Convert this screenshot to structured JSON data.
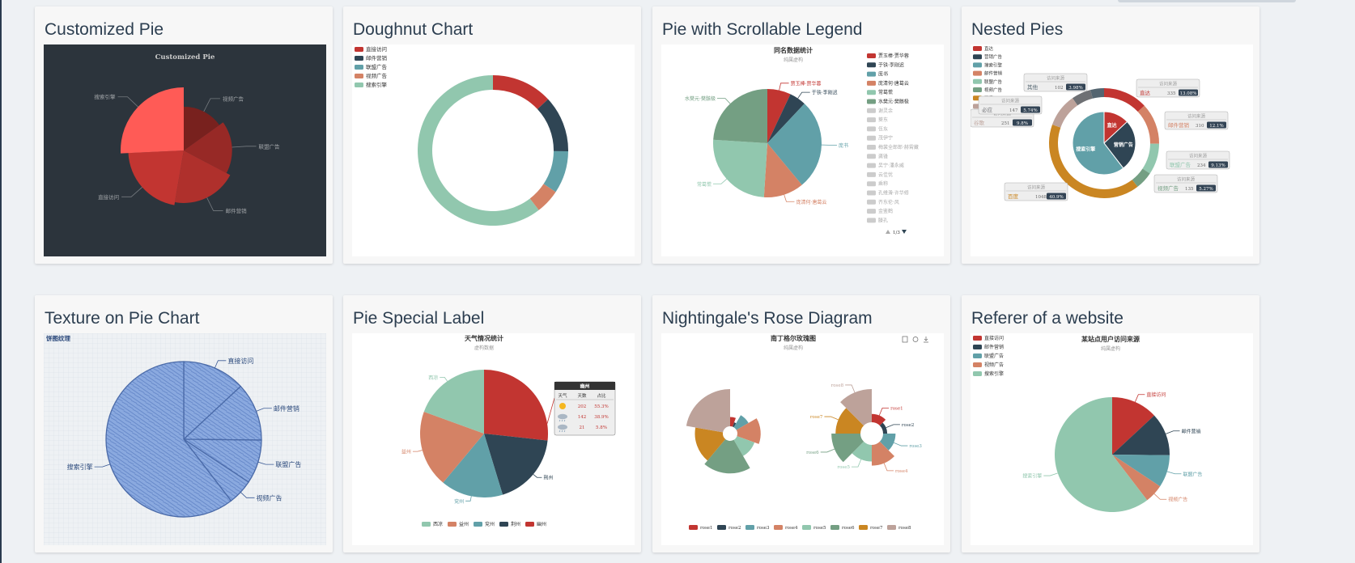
{
  "cards": [
    {
      "title": "Customized Pie"
    },
    {
      "title": "Doughnut Chart"
    },
    {
      "title": "Pie with Scrollable Legend"
    },
    {
      "title": "Nested Pies"
    },
    {
      "title": "Texture on Pie Chart"
    },
    {
      "title": "Pie Special Label"
    },
    {
      "title": "Nightingale's Rose Diagram"
    },
    {
      "title": "Referer of a website"
    }
  ],
  "chart_data": [
    {
      "type": "pie",
      "title": "Customized Pie",
      "roseType": "radius",
      "background": "#2c343c",
      "color": "#c23531",
      "categories": [
        "视频广告",
        "联盟广告",
        "邮件营销",
        "直接访问",
        "搜索引擎"
      ],
      "values": [
        235,
        274,
        310,
        335,
        400
      ],
      "labels": [
        "视频广告",
        "联盟广告",
        "邮件营销",
        "直接访问",
        "搜索引擎"
      ]
    },
    {
      "type": "pie",
      "donut": true,
      "legend": [
        "直接访问",
        "邮件营销",
        "联盟广告",
        "视频广告",
        "搜索引擎"
      ],
      "legend_position": "top-left",
      "values": [
        335,
        310,
        234,
        135,
        1548
      ],
      "colors": [
        "#c23531",
        "#2f4554",
        "#61a0a8",
        "#d48265",
        "#91c7ae"
      ]
    },
    {
      "type": "pie",
      "title": "同名数据统计",
      "subtitle": "纯属虚构",
      "legend_position": "right",
      "legend": [
        "贾玉棒·贾华蓉",
        "于铁·李刚迟",
        "庞书",
        "庞清何·唐葛云",
        "常葛慌",
        "水樊元·樊骸极",
        "谢灵余",
        "葵东",
        "伍东",
        "茂伊宁",
        "梅裳全郎郎·赫霄藏",
        "龚锋",
        "吴宁·潘永威",
        "云佳忧",
        "乘称",
        "孔维滑·许华修",
        "齐东伦·风",
        "金鉴鹤",
        "滕孔"
      ],
      "legend_active_count": 6,
      "legend_page": "1/3",
      "slices": [
        {
          "name": "贾玉棒·贾华蓉",
          "value": 7
        },
        {
          "name": "于铁·李刚迟",
          "value": 5
        },
        {
          "name": "庞书",
          "value": 27
        },
        {
          "name": "庞清何·唐葛云",
          "value": 12
        },
        {
          "name": "常葛慌",
          "value": 25
        },
        {
          "name": "水樊元·樊骸极",
          "value": 24
        }
      ],
      "colors": [
        "#c23531",
        "#2f4554",
        "#61a0a8",
        "#d48265",
        "#91c7ae",
        "#749f83"
      ]
    },
    {
      "type": "pie",
      "nested": true,
      "legend": [
        "直达",
        "营销广告",
        "搜索引擎",
        "邮件营销",
        "联盟广告",
        "视频广告",
        "百度",
        "谷歌",
        "必应",
        "其他"
      ],
      "legend_position": "top-left",
      "inner": [
        {
          "name": "直达",
          "value": 335
        },
        {
          "name": "营销广告",
          "value": 679
        },
        {
          "name": "搜索引擎",
          "value": 1548
        }
      ],
      "outer": [
        {
          "name": "直达",
          "value": 335,
          "pct": "13.08%"
        },
        {
          "name": "邮件营销",
          "value": 310,
          "pct": "12.1%"
        },
        {
          "name": "联盟广告",
          "value": 234,
          "pct": "9.13%"
        },
        {
          "name": "视频广告",
          "value": 135,
          "pct": "5.27%"
        },
        {
          "name": "百度",
          "value": 1048,
          "pct": "40.9%"
        },
        {
          "name": "谷歌",
          "value": 251,
          "pct": "9.8%"
        },
        {
          "name": "必应",
          "value": 147,
          "pct": "5.74%"
        },
        {
          "name": "其他",
          "value": 102,
          "pct": "3.98%"
        }
      ],
      "tooltip_title": "访问来源",
      "colors": [
        "#c23531",
        "#2f4554",
        "#61a0a8",
        "#d48265",
        "#91c7ae",
        "#749f83",
        "#ca8622",
        "#bda29a",
        "#6e7074",
        "#546570"
      ]
    },
    {
      "type": "pie",
      "title": "饼图纹理",
      "texture": true,
      "categories": [
        "直接访问",
        "邮件营销",
        "联盟广告",
        "视频广告",
        "搜索引擎"
      ],
      "values": [
        335,
        310,
        234,
        135,
        1548
      ]
    },
    {
      "type": "pie",
      "title": "天气情况统计",
      "subtitle": "虚构数据",
      "legend": [
        "西凉",
        "益州",
        "兖州",
        "荆州",
        "幽州"
      ],
      "legend_position": "bottom",
      "slices": [
        {
          "name": "幽州",
          "value": 735
        },
        {
          "name": "荆州",
          "value": 510
        },
        {
          "name": "兖州",
          "value": 434
        },
        {
          "name": "益州",
          "value": 535
        },
        {
          "name": "西凉",
          "value": 535
        }
      ],
      "colors": [
        "#c23531",
        "#2f4554",
        "#61a0a8",
        "#d48265",
        "#91c7ae"
      ],
      "special_label": {
        "title": "幽州",
        "headers": [
          "天气",
          "天数",
          "占比"
        ],
        "rows": [
          {
            "icon": "sunny-icon",
            "days": "202",
            "pct": "55.3%"
          },
          {
            "icon": "cloudy-icon",
            "days": "142",
            "pct": "38.9%"
          },
          {
            "icon": "showers-icon",
            "days": "21",
            "pct": "5.8%"
          }
        ]
      }
    },
    {
      "type": "pie",
      "roseType": true,
      "title": "南丁格尔玫瑰图",
      "subtitle": "纯属虚构",
      "legend": [
        "rose1",
        "rose2",
        "rose3",
        "rose4",
        "rose5",
        "rose6",
        "rose7",
        "rose8"
      ],
      "legend_position": "bottom",
      "left_series": [
        10,
        5,
        15,
        25,
        20,
        35,
        30,
        40
      ],
      "right_series": [
        10,
        5,
        15,
        25,
        20,
        35,
        30,
        40
      ],
      "colors": [
        "#c23531",
        "#2f4554",
        "#61a0a8",
        "#d48265",
        "#91c7ae",
        "#749f83",
        "#ca8622",
        "#bda29a"
      ],
      "toolbox": [
        "data-view-icon",
        "restore-icon",
        "save-icon"
      ]
    },
    {
      "type": "pie",
      "title": "某站点用户访问来源",
      "subtitle": "纯属虚构",
      "legend": [
        "直接访问",
        "邮件营销",
        "联盟广告",
        "视频广告",
        "搜索引擎"
      ],
      "legend_position": "top-left",
      "categories": [
        "直接访问",
        "邮件营销",
        "联盟广告",
        "视频广告",
        "搜索引擎"
      ],
      "values": [
        335,
        310,
        234,
        135,
        1548
      ],
      "colors": [
        "#c23531",
        "#2f4554",
        "#61a0a8",
        "#d48265",
        "#91c7ae"
      ]
    }
  ]
}
